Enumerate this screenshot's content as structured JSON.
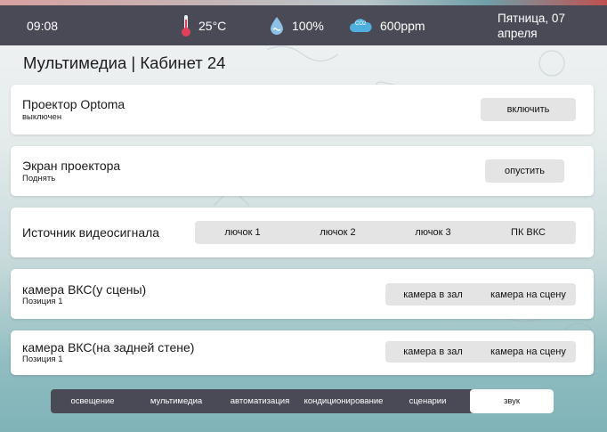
{
  "status": {
    "time": "09:08",
    "temperature": "25°C",
    "humidity": "100%",
    "co2": "600ppm",
    "co2_badge": "CO2",
    "date": "Пятница, 07 апреля"
  },
  "page": {
    "title": "Мультимедиа | Кабинет 24"
  },
  "cards": {
    "projector": {
      "title": "Проектор Optoma",
      "status": "выключен",
      "button": "включить"
    },
    "screen": {
      "title": "Экран проектора",
      "status": "Поднять",
      "button": "опустить"
    },
    "source": {
      "title": "Источник видеосигнала",
      "options": [
        "лючок 1",
        "лючок 2",
        "лючок 3",
        "ПК ВКС"
      ]
    },
    "camera_stage": {
      "title": "камера ВКС(у сцены)",
      "status": "Позиция 1",
      "options": [
        "камера в зал",
        "камера на сцену"
      ]
    },
    "camera_back": {
      "title": "камера ВКС(на задней стене)",
      "status": "Позиция 1",
      "options": [
        "камера в зал",
        "камера на сцену"
      ]
    }
  },
  "nav": {
    "tabs": [
      "освещение",
      "мультимедиа",
      "автоматизация",
      "кондиционирование",
      "сценарии",
      "звук"
    ],
    "active_index": 5
  },
  "colors": {
    "status_bar": "#4a4a56",
    "thermometer": "#e0405a",
    "drop": "#6aa6d6",
    "cloud": "#4fb0e0"
  },
  "icons": {
    "temperature": "thermometer-icon",
    "humidity": "water-drop-icon",
    "co2": "co2-cloud-icon"
  }
}
